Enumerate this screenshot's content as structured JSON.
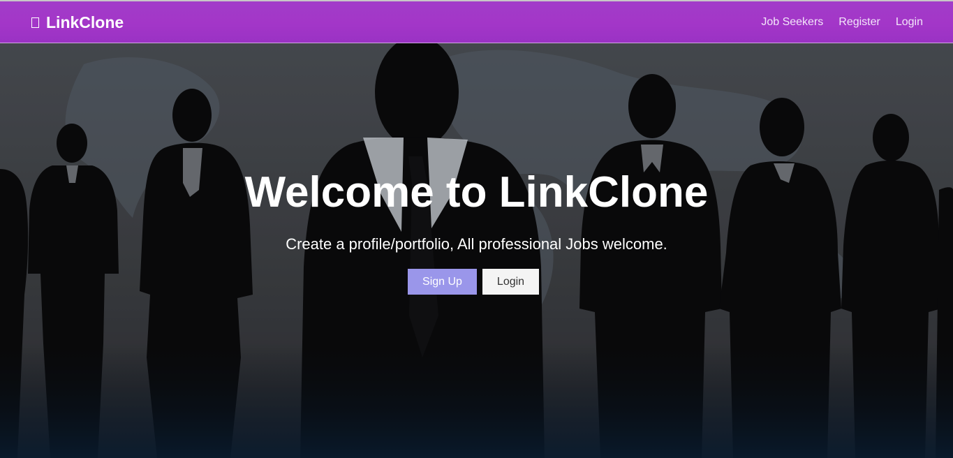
{
  "navbar": {
    "brand": "LinkClone",
    "brand_icon": "briefcase-icon",
    "links": [
      "Job Seekers",
      "Register",
      "Login"
    ],
    "background": "#a336c8"
  },
  "hero": {
    "title": "Welcome to LinkClone",
    "subtitle": "Create a profile/portfolio, All professional Jobs welcome.",
    "buttons": {
      "signup": "Sign Up",
      "login": "Login"
    },
    "colors": {
      "signup_bg": "#9a96ea",
      "login_bg": "#f4f4f4"
    }
  }
}
